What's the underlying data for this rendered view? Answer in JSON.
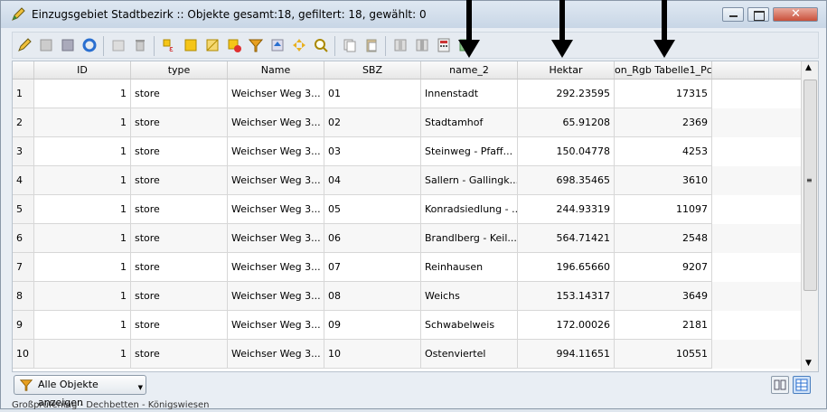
{
  "window": {
    "title": "Einzugsgebiet Stadtbezirk :: Objekte gesamt:18, gefiltert: 18, gewählt: 0"
  },
  "toolbar": {
    "icons": [
      "pencil-icon",
      "edit-icon",
      "save-icon",
      "refresh-icon",
      "delete-icon",
      "trash-icon",
      "select-expression-icon",
      "select-all-icon",
      "invert-selection-icon",
      "deselect-icon",
      "filter-icon",
      "move-top-icon",
      "pan-to-selected-icon",
      "zoom-to-selected-icon",
      "copy-icon",
      "paste-icon",
      "new-column-icon",
      "delete-column-icon",
      "field-calculator-icon",
      "conditional-formatting-icon"
    ]
  },
  "table": {
    "columns": [
      "ID",
      "type",
      "Name",
      "SBZ",
      "name_2",
      "Hektar",
      "on_Rgb Tabelle1_Pc"
    ],
    "rows": [
      {
        "rownum": "1",
        "ID": "1",
        "type": "store",
        "Name": "Weichser Weg 3...",
        "SBZ": "01",
        "name_2": "Innenstadt",
        "Hektar": "292.23595",
        "pc": "17315"
      },
      {
        "rownum": "2",
        "ID": "1",
        "type": "store",
        "Name": "Weichser Weg 3...",
        "SBZ": "02",
        "name_2": "Stadtamhof",
        "Hektar": "65.91208",
        "pc": "2369"
      },
      {
        "rownum": "3",
        "ID": "1",
        "type": "store",
        "Name": "Weichser Weg 3...",
        "SBZ": "03",
        "name_2": "Steinweg - Pfaff...",
        "Hektar": "150.04778",
        "pc": "4253"
      },
      {
        "rownum": "4",
        "ID": "1",
        "type": "store",
        "Name": "Weichser Weg 3...",
        "SBZ": "04",
        "name_2": "Sallern - Gallingk...",
        "Hektar": "698.35465",
        "pc": "3610"
      },
      {
        "rownum": "5",
        "ID": "1",
        "type": "store",
        "Name": "Weichser Weg 3...",
        "SBZ": "05",
        "name_2": "Konradsiedlung - ...",
        "Hektar": "244.93319",
        "pc": "11097"
      },
      {
        "rownum": "6",
        "ID": "1",
        "type": "store",
        "Name": "Weichser Weg 3...",
        "SBZ": "06",
        "name_2": "Brandlberg - Keil...",
        "Hektar": "564.71421",
        "pc": "2548"
      },
      {
        "rownum": "7",
        "ID": "1",
        "type": "store",
        "Name": "Weichser Weg 3...",
        "SBZ": "07",
        "name_2": "Reinhausen",
        "Hektar": "196.65660",
        "pc": "9207"
      },
      {
        "rownum": "8",
        "ID": "1",
        "type": "store",
        "Name": "Weichser Weg 3...",
        "SBZ": "08",
        "name_2": "Weichs",
        "Hektar": "153.14317",
        "pc": "3649"
      },
      {
        "rownum": "9",
        "ID": "1",
        "type": "store",
        "Name": "Weichser Weg 3...",
        "SBZ": "09",
        "name_2": "Schwabelweis",
        "Hektar": "172.00026",
        "pc": "2181"
      },
      {
        "rownum": "10",
        "ID": "1",
        "type": "store",
        "Name": "Weichser Weg 3...",
        "SBZ": "10",
        "name_2": "Ostenviertel",
        "Hektar": "994.11651",
        "pc": "10551"
      }
    ]
  },
  "footer": {
    "show_all_label": "Alle Objekte anzeigen",
    "background_caption": "Großprüfening - Dechbetten - Königswiesen"
  },
  "colors": {
    "titlebar": "#c8d6e6",
    "highlight_arrows": "#000000"
  }
}
